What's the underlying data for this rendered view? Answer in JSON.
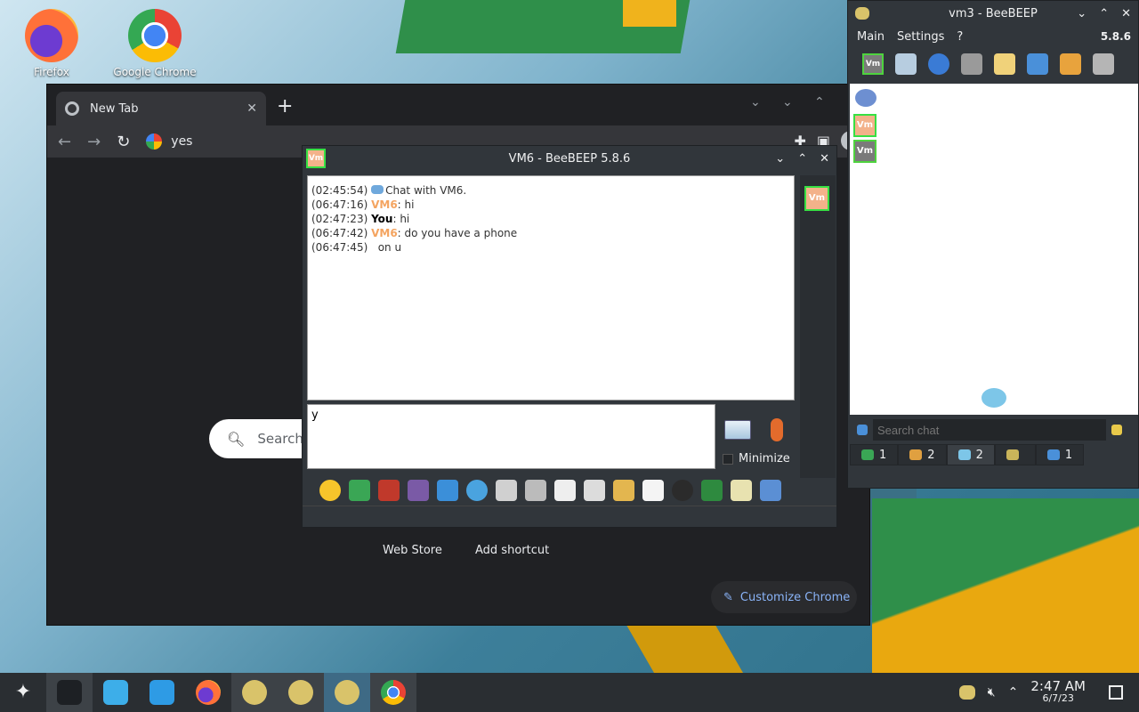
{
  "desktop": {
    "icons": [
      {
        "label": "Firefox"
      },
      {
        "label": "Google Chrome"
      }
    ]
  },
  "chrome": {
    "tab_title": "New Tab",
    "omnibox_text": "yes",
    "search_placeholder": "Search",
    "shortcuts": [
      "Web Store",
      "Add shortcut"
    ],
    "customize_label": "Customize Chrome"
  },
  "bee_chat": {
    "badge": "Vm",
    "title": "VM6 - BeeBEEP 5.8.6",
    "messages": [
      {
        "time": "(02:45:54)",
        "sender": "",
        "text": "Chat with VM6."
      },
      {
        "time": "(06:47:16)",
        "sender": "VM6",
        "text": ": hi"
      },
      {
        "time": "(02:47:23)",
        "sender": "You",
        "text": ": hi"
      },
      {
        "time": "(06:47:42)",
        "sender": "VM6",
        "text": ": do you have a phone"
      },
      {
        "time": "(06:47:45)",
        "sender": "",
        "text": "on u"
      }
    ],
    "input_value": "y",
    "minimize_label": "Minimize"
  },
  "bee_main": {
    "title": "vm3 - BeeBEEP",
    "menu": [
      "Main",
      "Settings",
      "?"
    ],
    "version": "5.8.6",
    "toolbar_badge": "Vm",
    "users": [
      {
        "badge": "Vm"
      },
      {
        "badge": "Vm"
      }
    ],
    "search_placeholder": "Search chat",
    "tabs": [
      {
        "count": "1"
      },
      {
        "count": "2"
      },
      {
        "count": "2"
      },
      {
        "count": ""
      },
      {
        "count": "1"
      }
    ]
  },
  "taskbar": {
    "time": "2:47 AM",
    "date": "6/7/23"
  }
}
